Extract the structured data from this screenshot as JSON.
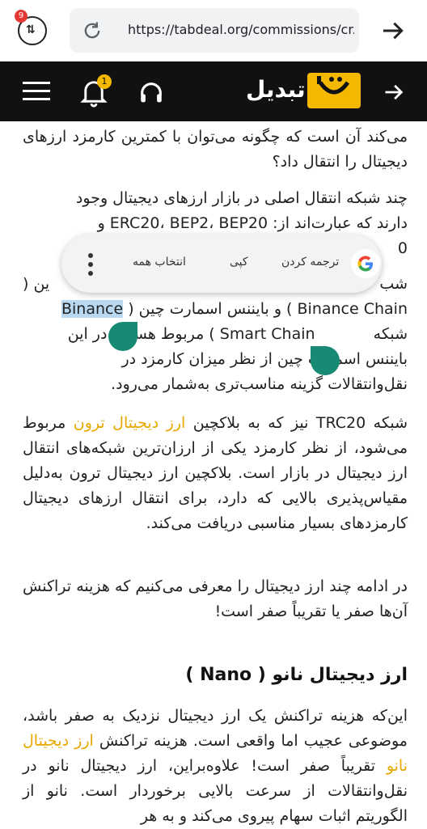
{
  "browser": {
    "tab_count": "9",
    "url": "https://tabdeal.org/commissions/cr..."
  },
  "site": {
    "brand": "تبدیل",
    "notification_count": "1"
  },
  "text_popup": {
    "translate": "ترجمه کردن",
    "copy": "کپی",
    "select_all": "انتخاب همه"
  },
  "article": {
    "p1": "می‌کند آن است که چگونه می‌توان با کمترین کارمزد ارزهای دیجیتال را انتقال داد؟",
    "p2_l1": "چند شبکه انتقال اصلی در بازار ارزهای دیجیتال وجود",
    "p2_l2": "دارند که عبارت‌اند از: ERC20، BEP2، BEP20 و",
    "p2_l3": "0",
    "p3_l1": "شب",
    "p3_l1b": "ین (",
    "p3_l2_sel": "Binance",
    "p3_l2": "Binance Chain ) و بایننس اسمارت چین (",
    "p3_l3": "Smart Chain ) مربوط هستند. در این",
    "p3_l3b": "شبکه",
    "p3_l4": "بایننس اسمارت چین از نظر میزان کارمزد در",
    "p3_l5": "نقل‌وانتقالات گزینه مناسب‌تری به‌شمار می‌رود.",
    "p4_pre": "شبکه TRC20 نیز که به بلاکچین ",
    "p4_link": "ارز دیجیتال ترون",
    "p4_rest": "مربوط می‌شود، از نظر کارمزد یکی از ارزان‌ترین شبکه‌های انتقال ارز دیجیتال در بازار است. بلاکچین ارز دیجیتال ترون به‌دلیل مقیاس‌پذیری بالایی که دارد، برای انتقال ارزهای دیجیتال کارمزدهای بسیار مناسبی دریافت می‌کند.",
    "p5": "در ادامه چند ارز دیجیتال را معرفی می‌کنیم که هزینه تراکنش آن‌ها صفر یا تقریباً صفر است!",
    "h_nano": "ارز دیجیتال نانو ( Nano )",
    "p6_a": "این‌که هزینه تراکنش یک ارز دیجیتال نزدیک به صفر باشد، موضوعی عجیب اما واقعی است. هزینه تراکنش",
    "p6_link": "ارز دیجیتال نانو",
    "p6_b": " تقریباً صفر است! علاوه‌براین، ارز",
    "p6_c": "دیجیتال نانو در نقل‌وانتقالات از سرعت بالایی برخوردار است. نانو از الگوریتم اثبات سهام پیروی می‌کند و به هر"
  },
  "colors": {
    "link": "#e8a800",
    "selection": "#b9d9f2",
    "handle": "#168a72",
    "header_bg": "#111111",
    "brand_yellow": "#f5b800"
  }
}
